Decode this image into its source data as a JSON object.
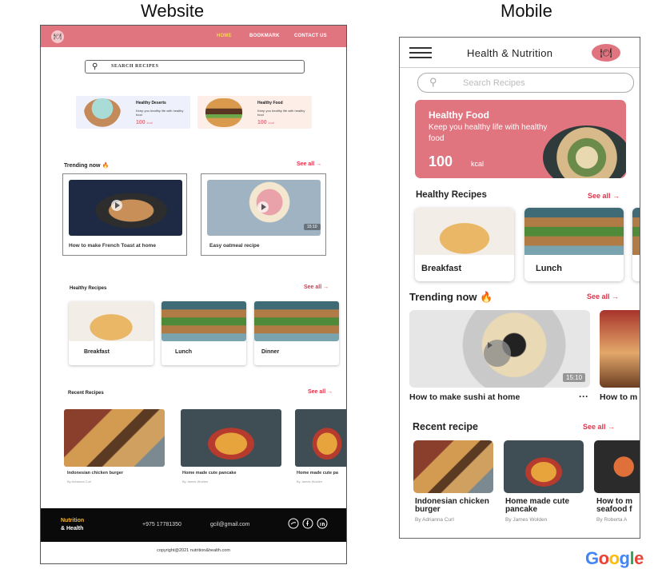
{
  "captions": {
    "website": "Website",
    "mobile": "Mobile"
  },
  "website": {
    "nav": {
      "logo": "🍽",
      "links": [
        "HOME",
        "BOOKMARK",
        "CONTACT US"
      ]
    },
    "search": {
      "placeholder": "SEARCH RECIPES"
    },
    "promos": [
      {
        "title": "Healthy Deserts",
        "desc": "Keep you healthy life with healthy food",
        "value": "100",
        "unit": "kcal"
      },
      {
        "title": "Healthy Food",
        "desc": "Keep you healthy life with healthy food",
        "value": "100",
        "unit": "kcal"
      }
    ],
    "trending": {
      "title": "Trending now 🔥",
      "see_all": "See all →",
      "items": [
        "How to make French Toast at home",
        "Easy oatmeal recipe"
      ],
      "duration": "15:10"
    },
    "healthy": {
      "title": "Healthy Recipes",
      "see_all": "See all →",
      "items": [
        "Breakfast",
        "Lunch",
        "Dinner"
      ]
    },
    "recent": {
      "title": "Recent Recipes",
      "see_all": "See all →",
      "items": [
        {
          "title": "Indonesian chicken burger",
          "author": "By Adrianna Curl"
        },
        {
          "title": "Home made cute pancake",
          "author": "By James Wolden"
        },
        {
          "title": "Home made cute pa",
          "author": "By James Wolden"
        }
      ]
    },
    "footer": {
      "brand_line1": "Nutrition",
      "brand_line2": "& Health",
      "phone": "+975 17781350",
      "email": "gcil@gmail.com",
      "copyright": "copyright@2021 nutrition&health.com"
    }
  },
  "mobile": {
    "title": "Health & Nutrition",
    "logo": "🍽",
    "search": {
      "placeholder": "Search Recipes"
    },
    "hero": {
      "title": "Healthy Food",
      "desc": "Keep you healthy life with healthy food",
      "value": "100",
      "unit": "kcal"
    },
    "healthy": {
      "title": "Healthy Recipes",
      "see_all": "See all →",
      "items": [
        "Breakfast",
        "Lunch"
      ]
    },
    "trending": {
      "title": "Trending now 🔥",
      "see_all": "See all →",
      "items": [
        "How to make sushi at home",
        "How to m"
      ],
      "duration": "15:10",
      "more": "···"
    },
    "recent": {
      "title": "Recent recipe",
      "see_all": "See all →",
      "items": [
        {
          "title": "Indonesian chicken burger",
          "author": "By Adrianna Curl"
        },
        {
          "title": "Home made cute pancake",
          "author": "By James Wolden"
        },
        {
          "title": "How to m seafood f",
          "author": "By Roberta A"
        }
      ]
    }
  },
  "brand": {
    "google": "Google"
  },
  "colors": {
    "accent": "#e07580",
    "link": "#e0334a",
    "footer": "#0a0a0a",
    "gold": "#f7d35b"
  }
}
